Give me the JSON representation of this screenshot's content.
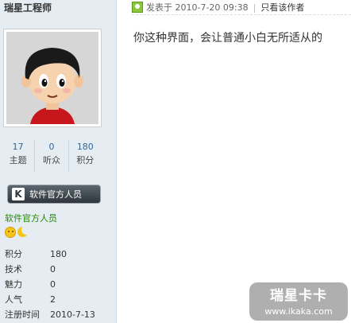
{
  "user": {
    "name": "瑞星工程师",
    "stats": [
      {
        "value": "17",
        "label": "主题"
      },
      {
        "value": "0",
        "label": "听众"
      },
      {
        "value": "180",
        "label": "积分"
      }
    ],
    "badge_text": "软件官方人员",
    "group": "软件官方人员",
    "info": [
      {
        "label": "积分",
        "value": "180"
      },
      {
        "label": "技术",
        "value": "0"
      },
      {
        "label": "魅力",
        "value": "0"
      },
      {
        "label": "人气",
        "value": "2"
      },
      {
        "label": "注册时间",
        "value": "2010-7-13"
      }
    ]
  },
  "post": {
    "posted_at": "发表于 2010-7-20 09:38",
    "only_author": "只看该作者",
    "content": "你这种界面，会让普通小白无所适从的"
  },
  "watermark": {
    "title": "瑞星卡卡",
    "url": "www.ikaka.com"
  }
}
